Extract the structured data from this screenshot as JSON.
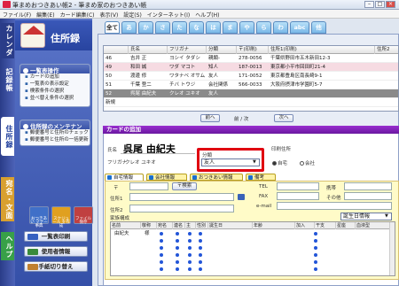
{
  "window": {
    "title": "筆まめおつきあい帳2 - 筆まめ家のおつきあい帳"
  },
  "menu": [
    "ファイル(F)",
    "編集(E)",
    "カード編集(C)",
    "表示(V)",
    "設定(S)",
    "インターネット(I)",
    "ヘルプ(H)"
  ],
  "rail": {
    "tab1": "カレンダー",
    "tab2": "記録帳",
    "tab3": "住所録",
    "tab4": "宛名・文面",
    "tab5": "ヘルプ"
  },
  "sidebar": {
    "title": "住所録",
    "panel1": {
      "title": "一覧表操作",
      "items": [
        "カードの追加",
        "一覧表の表示設定",
        "検索条件の選択",
        "並べ替え条件の選択"
      ]
    },
    "panel2": {
      "title": "住所録のメンテナンス",
      "items": [
        "郵便番号と住所のチェック",
        "郵便番号と住所の一括更新"
      ]
    },
    "sq_buttons": [
      "おつきあい\nマナー事典",
      "スケジュール\nを作成",
      "ファイル\n保存"
    ],
    "buttons": [
      "一覧表印刷",
      "使用者情報",
      "手紙切り替え"
    ]
  },
  "kana_tabs": [
    "全て",
    "あ",
    "か",
    "さ",
    "た",
    "な",
    "は",
    "ま",
    "や",
    "ら",
    "わ",
    "abc",
    "他"
  ],
  "table": {
    "headers": [
      "",
      "氏名",
      "フリガナ",
      "分類",
      "〒(印刷)",
      "住所1(印刷)",
      "住所2"
    ],
    "rows": [
      {
        "no": "46",
        "name": "吉井 正",
        "kana": "ヨシイ タダシ",
        "bunrui": "親類-",
        "zip": "278-0056",
        "addr": "千葉県野田市五木新田12-3",
        "pink": false,
        "sel": false
      },
      {
        "no": "49",
        "name": "和田 誠",
        "kana": "ワダ マコト",
        "bunrui": "知人",
        "zip": "187-0013",
        "addr": "東京都小平市回田町21-4",
        "pink": true,
        "sel": false
      },
      {
        "no": "50",
        "name": "渡邊 修",
        "kana": "ワタナベ オサム",
        "bunrui": "友人",
        "zip": "171-0052",
        "addr": "東京都豊島区南長崎9-1",
        "pink": false,
        "sel": false
      },
      {
        "no": "51",
        "name": "千葉 登二",
        "kana": "チバ トウジ",
        "bunrui": "会社関係",
        "zip": "566-0033",
        "addr": "大阪府摂津市学園町5-7",
        "pink": false,
        "sel": false
      },
      {
        "no": "52",
        "name": "呉尾 由紀夫",
        "kana": "クレオ ユキオ",
        "bunrui": "友人",
        "zip": "",
        "addr": "",
        "pink": false,
        "sel": true
      },
      {
        "no": "新規",
        "name": "",
        "kana": "",
        "bunrui": "",
        "zip": "",
        "addr": "",
        "pink": false,
        "sel": false
      }
    ]
  },
  "nav": {
    "prev": "前へ",
    "center": "前 / 次",
    "next": "次へ"
  },
  "card": {
    "header": "カードの追加",
    "name_label": "氏名",
    "name": "呉尾 由紀夫",
    "kana_label": "フリガナ",
    "kana": "クレオ ユキオ",
    "bunrui_label": "分類",
    "bunrui_value": "友人",
    "print_label": "印刷住所",
    "opt_home": "自宅",
    "opt_company": "会社",
    "subtabs": [
      "自宅情報",
      "会社情報",
      "おつきあい情報",
      "備考"
    ],
    "zip_label": "〒",
    "zip_btn": "〒検索",
    "addr1_label": "住所1",
    "addr2_label": "住所2",
    "tel_label": "TEL",
    "fax_label": "FAX",
    "email_label": "e-mail",
    "mobile_label": "携帯",
    "other_label": "その他",
    "family_label": "家族構成",
    "family_select": "誕生日情報",
    "family_headers": [
      "名前",
      "敬称",
      "宛名",
      "連名",
      "主",
      "性別",
      "誕生日",
      "年齢",
      "加入",
      "干支",
      "星座",
      "血液型"
    ],
    "family_rows": [
      {
        "name": "由紀夫",
        "keisho": "様"
      }
    ]
  }
}
